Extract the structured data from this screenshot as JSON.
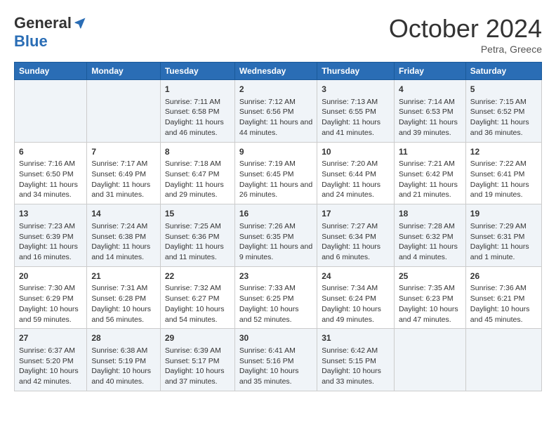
{
  "logo": {
    "general": "General",
    "blue": "Blue"
  },
  "title": "October 2024",
  "location": "Petra, Greece",
  "days_header": [
    "Sunday",
    "Monday",
    "Tuesday",
    "Wednesday",
    "Thursday",
    "Friday",
    "Saturday"
  ],
  "weeks": [
    [
      {
        "day": "",
        "content": ""
      },
      {
        "day": "",
        "content": ""
      },
      {
        "day": "1",
        "content": "Sunrise: 7:11 AM\nSunset: 6:58 PM\nDaylight: 11 hours and 46 minutes."
      },
      {
        "day": "2",
        "content": "Sunrise: 7:12 AM\nSunset: 6:56 PM\nDaylight: 11 hours and 44 minutes."
      },
      {
        "day": "3",
        "content": "Sunrise: 7:13 AM\nSunset: 6:55 PM\nDaylight: 11 hours and 41 minutes."
      },
      {
        "day": "4",
        "content": "Sunrise: 7:14 AM\nSunset: 6:53 PM\nDaylight: 11 hours and 39 minutes."
      },
      {
        "day": "5",
        "content": "Sunrise: 7:15 AM\nSunset: 6:52 PM\nDaylight: 11 hours and 36 minutes."
      }
    ],
    [
      {
        "day": "6",
        "content": "Sunrise: 7:16 AM\nSunset: 6:50 PM\nDaylight: 11 hours and 34 minutes."
      },
      {
        "day": "7",
        "content": "Sunrise: 7:17 AM\nSunset: 6:49 PM\nDaylight: 11 hours and 31 minutes."
      },
      {
        "day": "8",
        "content": "Sunrise: 7:18 AM\nSunset: 6:47 PM\nDaylight: 11 hours and 29 minutes."
      },
      {
        "day": "9",
        "content": "Sunrise: 7:19 AM\nSunset: 6:45 PM\nDaylight: 11 hours and 26 minutes."
      },
      {
        "day": "10",
        "content": "Sunrise: 7:20 AM\nSunset: 6:44 PM\nDaylight: 11 hours and 24 minutes."
      },
      {
        "day": "11",
        "content": "Sunrise: 7:21 AM\nSunset: 6:42 PM\nDaylight: 11 hours and 21 minutes."
      },
      {
        "day": "12",
        "content": "Sunrise: 7:22 AM\nSunset: 6:41 PM\nDaylight: 11 hours and 19 minutes."
      }
    ],
    [
      {
        "day": "13",
        "content": "Sunrise: 7:23 AM\nSunset: 6:39 PM\nDaylight: 11 hours and 16 minutes."
      },
      {
        "day": "14",
        "content": "Sunrise: 7:24 AM\nSunset: 6:38 PM\nDaylight: 11 hours and 14 minutes."
      },
      {
        "day": "15",
        "content": "Sunrise: 7:25 AM\nSunset: 6:36 PM\nDaylight: 11 hours and 11 minutes."
      },
      {
        "day": "16",
        "content": "Sunrise: 7:26 AM\nSunset: 6:35 PM\nDaylight: 11 hours and 9 minutes."
      },
      {
        "day": "17",
        "content": "Sunrise: 7:27 AM\nSunset: 6:34 PM\nDaylight: 11 hours and 6 minutes."
      },
      {
        "day": "18",
        "content": "Sunrise: 7:28 AM\nSunset: 6:32 PM\nDaylight: 11 hours and 4 minutes."
      },
      {
        "day": "19",
        "content": "Sunrise: 7:29 AM\nSunset: 6:31 PM\nDaylight: 11 hours and 1 minute."
      }
    ],
    [
      {
        "day": "20",
        "content": "Sunrise: 7:30 AM\nSunset: 6:29 PM\nDaylight: 10 hours and 59 minutes."
      },
      {
        "day": "21",
        "content": "Sunrise: 7:31 AM\nSunset: 6:28 PM\nDaylight: 10 hours and 56 minutes."
      },
      {
        "day": "22",
        "content": "Sunrise: 7:32 AM\nSunset: 6:27 PM\nDaylight: 10 hours and 54 minutes."
      },
      {
        "day": "23",
        "content": "Sunrise: 7:33 AM\nSunset: 6:25 PM\nDaylight: 10 hours and 52 minutes."
      },
      {
        "day": "24",
        "content": "Sunrise: 7:34 AM\nSunset: 6:24 PM\nDaylight: 10 hours and 49 minutes."
      },
      {
        "day": "25",
        "content": "Sunrise: 7:35 AM\nSunset: 6:23 PM\nDaylight: 10 hours and 47 minutes."
      },
      {
        "day": "26",
        "content": "Sunrise: 7:36 AM\nSunset: 6:21 PM\nDaylight: 10 hours and 45 minutes."
      }
    ],
    [
      {
        "day": "27",
        "content": "Sunrise: 6:37 AM\nSunset: 5:20 PM\nDaylight: 10 hours and 42 minutes."
      },
      {
        "day": "28",
        "content": "Sunrise: 6:38 AM\nSunset: 5:19 PM\nDaylight: 10 hours and 40 minutes."
      },
      {
        "day": "29",
        "content": "Sunrise: 6:39 AM\nSunset: 5:17 PM\nDaylight: 10 hours and 37 minutes."
      },
      {
        "day": "30",
        "content": "Sunrise: 6:41 AM\nSunset: 5:16 PM\nDaylight: 10 hours and 35 minutes."
      },
      {
        "day": "31",
        "content": "Sunrise: 6:42 AM\nSunset: 5:15 PM\nDaylight: 10 hours and 33 minutes."
      },
      {
        "day": "",
        "content": ""
      },
      {
        "day": "",
        "content": ""
      }
    ]
  ]
}
